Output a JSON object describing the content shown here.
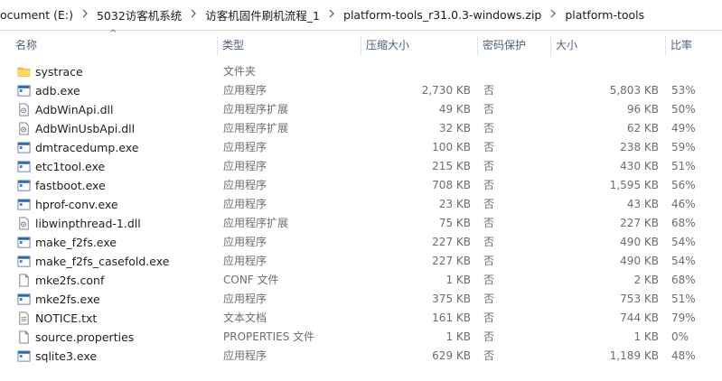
{
  "breadcrumb": [
    "ocument (E:)",
    "5032访客机系统",
    "访客机固件刷机流程_1",
    "platform-tools_r31.0.3-windows.zip",
    "platform-tools"
  ],
  "columns": {
    "name": "名称",
    "type": "类型",
    "compressed": "压缩大小",
    "protected": "密码保护",
    "size": "大小",
    "ratio": "比率"
  },
  "sort_indicator": "^",
  "files": [
    {
      "name": "systrace",
      "type": "文件夹",
      "compressed": "",
      "protected": "",
      "size": "",
      "ratio": "",
      "icon": "folder-icon"
    },
    {
      "name": "adb.exe",
      "type": "应用程序",
      "compressed": "2,730 KB",
      "protected": "否",
      "size": "5,803 KB",
      "ratio": "53%",
      "icon": "exe-icon"
    },
    {
      "name": "AdbWinApi.dll",
      "type": "应用程序扩展",
      "compressed": "49 KB",
      "protected": "否",
      "size": "96 KB",
      "ratio": "50%",
      "icon": "dll-icon"
    },
    {
      "name": "AdbWinUsbApi.dll",
      "type": "应用程序扩展",
      "compressed": "32 KB",
      "protected": "否",
      "size": "62 KB",
      "ratio": "49%",
      "icon": "dll-icon"
    },
    {
      "name": "dmtracedump.exe",
      "type": "应用程序",
      "compressed": "100 KB",
      "protected": "否",
      "size": "238 KB",
      "ratio": "59%",
      "icon": "exe-icon"
    },
    {
      "name": "etc1tool.exe",
      "type": "应用程序",
      "compressed": "215 KB",
      "protected": "否",
      "size": "430 KB",
      "ratio": "51%",
      "icon": "exe-icon"
    },
    {
      "name": "fastboot.exe",
      "type": "应用程序",
      "compressed": "708 KB",
      "protected": "否",
      "size": "1,595 KB",
      "ratio": "56%",
      "icon": "exe-icon"
    },
    {
      "name": "hprof-conv.exe",
      "type": "应用程序",
      "compressed": "23 KB",
      "protected": "否",
      "size": "43 KB",
      "ratio": "46%",
      "icon": "exe-icon"
    },
    {
      "name": "libwinpthread-1.dll",
      "type": "应用程序扩展",
      "compressed": "75 KB",
      "protected": "否",
      "size": "227 KB",
      "ratio": "68%",
      "icon": "dll-icon"
    },
    {
      "name": "make_f2fs.exe",
      "type": "应用程序",
      "compressed": "227 KB",
      "protected": "否",
      "size": "490 KB",
      "ratio": "54%",
      "icon": "exe-icon"
    },
    {
      "name": "make_f2fs_casefold.exe",
      "type": "应用程序",
      "compressed": "227 KB",
      "protected": "否",
      "size": "490 KB",
      "ratio": "54%",
      "icon": "exe-icon"
    },
    {
      "name": "mke2fs.conf",
      "type": "CONF 文件",
      "compressed": "1 KB",
      "protected": "否",
      "size": "2 KB",
      "ratio": "68%",
      "icon": "file-icon"
    },
    {
      "name": "mke2fs.exe",
      "type": "应用程序",
      "compressed": "375 KB",
      "protected": "否",
      "size": "753 KB",
      "ratio": "51%",
      "icon": "exe-icon"
    },
    {
      "name": "NOTICE.txt",
      "type": "文本文档",
      "compressed": "161 KB",
      "protected": "否",
      "size": "744 KB",
      "ratio": "79%",
      "icon": "text-file-icon"
    },
    {
      "name": "source.properties",
      "type": "PROPERTIES 文件",
      "compressed": "1 KB",
      "protected": "否",
      "size": "1 KB",
      "ratio": "0%",
      "icon": "file-icon"
    },
    {
      "name": "sqlite3.exe",
      "type": "应用程序",
      "compressed": "629 KB",
      "protected": "否",
      "size": "1,189 KB",
      "ratio": "48%",
      "icon": "exe-icon"
    }
  ],
  "colors": {
    "header_text": "#4c607a",
    "secondary_text": "#6d6d6d",
    "folder": "#f5c542",
    "exe_blue": "#1f5fa8"
  }
}
